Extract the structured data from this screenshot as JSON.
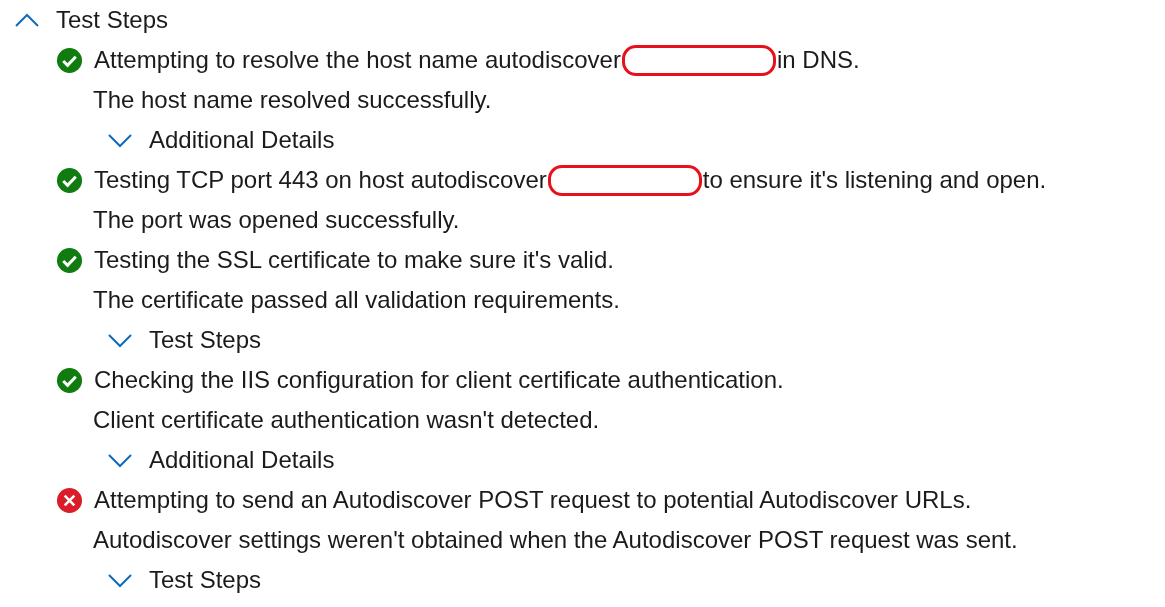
{
  "header": {
    "label": "Test Steps",
    "expanded": true
  },
  "steps": [
    {
      "passed": true,
      "text_before": "Attempting to resolve the host name autodiscover",
      "redacted": true,
      "text_after": "in DNS.",
      "result": "The host name resolved successfully.",
      "expander": {
        "label": "Additional Details",
        "expanded": false
      }
    },
    {
      "passed": true,
      "text_before": "Testing TCP port 443 on host autodiscover",
      "redacted": true,
      "text_after": "to ensure it's listening and open.",
      "result": "The port was opened successfully."
    },
    {
      "passed": true,
      "text_before": "Testing the SSL certificate to make sure it's valid.",
      "redacted": false,
      "result": "The certificate passed all validation requirements.",
      "expander": {
        "label": "Test Steps",
        "expanded": false
      }
    },
    {
      "passed": true,
      "text_before": "Checking the IIS configuration for client certificate authentication.",
      "redacted": false,
      "result": "Client certificate authentication wasn't detected.",
      "expander": {
        "label": "Additional Details",
        "expanded": false
      }
    },
    {
      "passed": false,
      "text_before": "Attempting to send an Autodiscover POST request to potential Autodiscover URLs.",
      "redacted": false,
      "result": "Autodiscover settings weren't obtained when the Autodiscover POST request was sent.",
      "expander": {
        "label": "Test Steps",
        "expanded": false
      }
    }
  ]
}
